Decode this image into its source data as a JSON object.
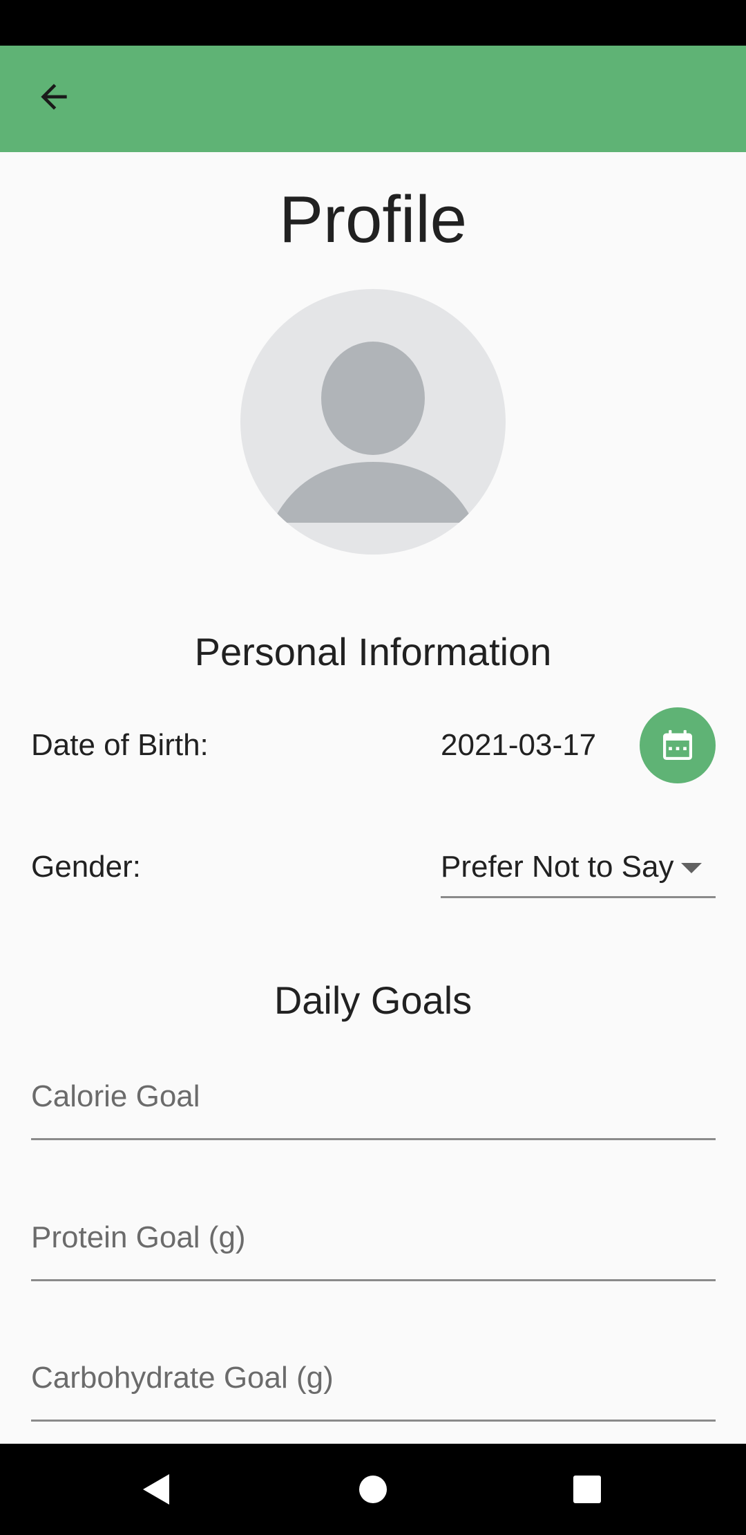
{
  "header": {
    "back_icon": "arrow-back-icon",
    "color": "#5fb375"
  },
  "page": {
    "title": "Profile"
  },
  "avatar": {
    "icon": "person-placeholder-icon"
  },
  "personal_info": {
    "heading": "Personal Information",
    "dob_label": "Date of Birth:",
    "dob_value": "2021-03-17",
    "calendar_icon": "calendar-icon",
    "gender_label": "Gender:",
    "gender_value": "Prefer Not to Say"
  },
  "daily_goals": {
    "heading": "Daily Goals",
    "fields": [
      {
        "placeholder": "Calorie Goal",
        "value": ""
      },
      {
        "placeholder": "Protein Goal (g)",
        "value": ""
      },
      {
        "placeholder": "Carbohydrate Goal (g)",
        "value": ""
      }
    ]
  },
  "nav": {
    "back_icon": "nav-back-icon",
    "home_icon": "nav-home-icon",
    "recents_icon": "nav-recents-icon"
  }
}
